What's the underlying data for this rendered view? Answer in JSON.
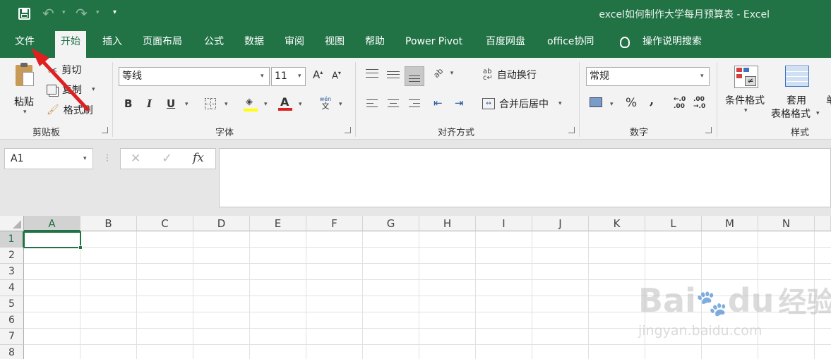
{
  "title_bar": {
    "title": "excel如何制作大学每月预算表  -  Excel",
    "icons": [
      "save-icon",
      "undo-icon",
      "redo-icon",
      "customize-qat-icon"
    ]
  },
  "tabs": [
    "文件",
    "开始",
    "插入",
    "页面布局",
    "公式",
    "数据",
    "审阅",
    "视图",
    "帮助",
    "Power Pivot",
    "百度网盘",
    "office协同"
  ],
  "active_tab": "开始",
  "tell_me": "操作说明搜索",
  "clipboard": {
    "paste": "粘贴",
    "cut": "剪切",
    "copy": "复制",
    "format_painter": "格式刷",
    "group": "剪贴板"
  },
  "font": {
    "name": "等线",
    "size": "11",
    "group": "字体",
    "bold": "B",
    "italic": "I",
    "underline": "U",
    "color_a": "A",
    "phonetic_top": "wén",
    "phonetic_bottom": "文"
  },
  "alignment": {
    "wrap_text": "自动换行",
    "merge_center": "合并后居中",
    "group": "对齐方式",
    "orientation_label": "ab"
  },
  "number": {
    "format": "常规",
    "group": "数字",
    "percent": "%",
    "comma": ",",
    "inc_decimal": "←.0\n.00",
    "dec_decimal": ".00\n→.0"
  },
  "styles": {
    "conditional": "条件格式",
    "as_table": "套用",
    "as_table2": "表格格式",
    "group": "样式",
    "partial": "单"
  },
  "formula_bar": {
    "name_box": "A1",
    "fx": "fx",
    "formula_value": ""
  },
  "columns": [
    "A",
    "B",
    "C",
    "D",
    "E",
    "F",
    "G",
    "H",
    "I",
    "J",
    "K",
    "L",
    "M",
    "N"
  ],
  "rows": [
    "1",
    "2",
    "3",
    "4",
    "5",
    "6",
    "7",
    "8"
  ],
  "selected_cell": "A1",
  "watermark": {
    "line1": "Bai",
    "line2": "du",
    "line3": "经验",
    "url": "jingyan.baidu.com"
  },
  "colors": {
    "accent": "#217346",
    "arrow": "#e02020",
    "font_color": "#e02020",
    "highlight": "#ffff00"
  }
}
